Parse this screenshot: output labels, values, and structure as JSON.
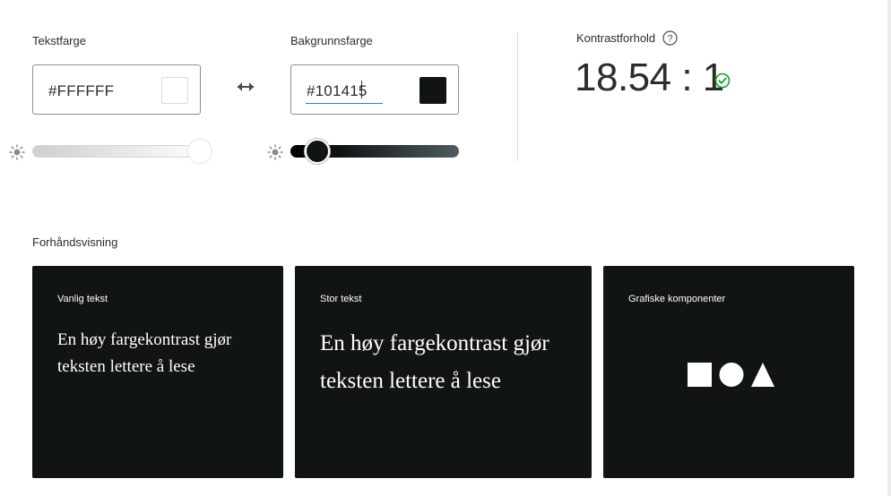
{
  "text_color": {
    "label": "Tekstfarge",
    "value": "#FFFFFF",
    "swatch_color": "#FFFFFF",
    "brightness_level": 1.0
  },
  "swap_button": {
    "icon": "swap-arrows-icon"
  },
  "background_color": {
    "label": "Bakgrunnsfarge",
    "value": "#101415",
    "swatch_color": "#101415",
    "brightness_level": 0.17
  },
  "contrast": {
    "label": "Kontrastforhold",
    "ratio": "18.54 : 1",
    "status_icon": "check-circle-icon",
    "status_color": "#12a326"
  },
  "preview": {
    "label": "Forhåndsvisning",
    "cards": [
      {
        "title": "Vanlig tekst",
        "sample": "En høy fargekontrast gjør teksten lettere å lese"
      },
      {
        "title": "Stor tekst",
        "sample": "En høy fargekontrast gjør teksten lettere å lese"
      },
      {
        "title": "Grafiske komponenter",
        "shapes": [
          "square",
          "circle",
          "triangle"
        ]
      }
    ]
  }
}
